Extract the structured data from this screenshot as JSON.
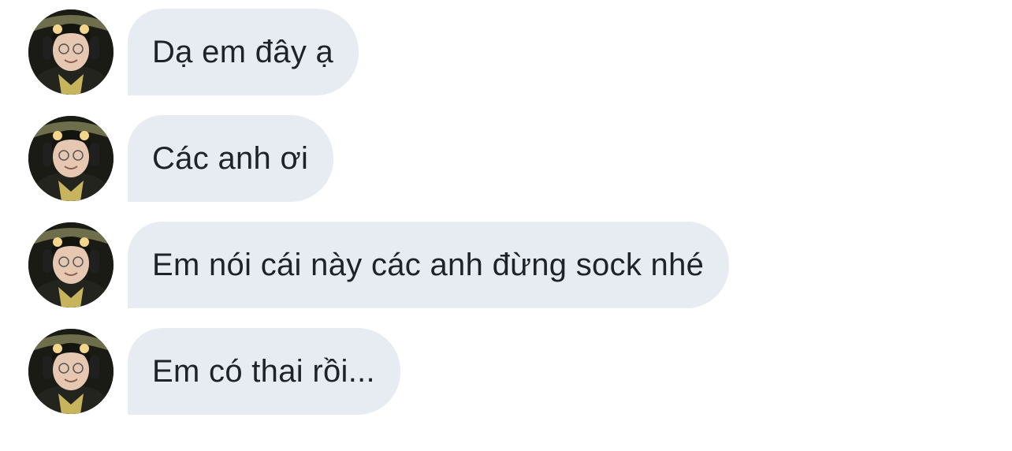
{
  "conversation": {
    "messages": [
      {
        "text": "Dạ em đây ạ",
        "avatar_icon": "user-avatar"
      },
      {
        "text": "Các anh ơi",
        "avatar_icon": "user-avatar"
      },
      {
        "text": "Em nói cái này các anh đừng sock nhé",
        "avatar_icon": "user-avatar"
      },
      {
        "text": "Em có thai rồi...",
        "avatar_icon": "user-avatar"
      }
    ]
  },
  "colors": {
    "bubble_background": "#e6ecf1",
    "bubble_text": "#1f2329",
    "page_background": "#ffffff"
  }
}
